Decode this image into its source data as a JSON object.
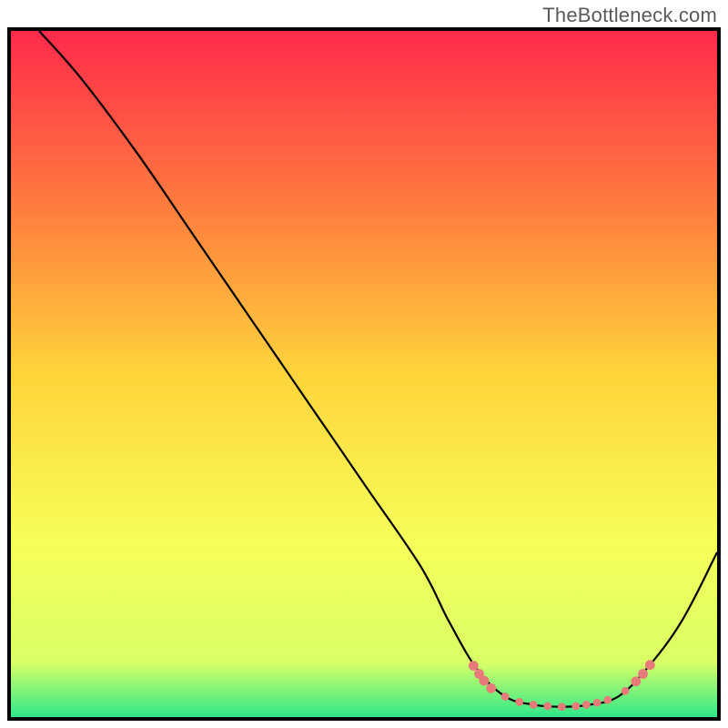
{
  "watermark": "TheBottleneck.com",
  "chart_data": {
    "type": "line",
    "title": "",
    "xlabel": "",
    "ylabel": "",
    "xlim": [
      0,
      100
    ],
    "ylim": [
      0,
      100
    ],
    "gradient_stops": [
      {
        "offset": 0,
        "color": "#ff2a4b"
      },
      {
        "offset": 25,
        "color": "#ff7a3e"
      },
      {
        "offset": 50,
        "color": "#ffd43b"
      },
      {
        "offset": 75,
        "color": "#f6ff5a"
      },
      {
        "offset": 92,
        "color": "#d9ff66"
      },
      {
        "offset": 100,
        "color": "#2ee88a"
      }
    ],
    "curve": [
      {
        "x": 4,
        "y": 100
      },
      {
        "x": 10,
        "y": 93
      },
      {
        "x": 18,
        "y": 82
      },
      {
        "x": 26,
        "y": 70
      },
      {
        "x": 34,
        "y": 58
      },
      {
        "x": 42,
        "y": 46
      },
      {
        "x": 50,
        "y": 34
      },
      {
        "x": 58,
        "y": 22
      },
      {
        "x": 62,
        "y": 14
      },
      {
        "x": 66,
        "y": 7
      },
      {
        "x": 70,
        "y": 3
      },
      {
        "x": 74,
        "y": 1.8
      },
      {
        "x": 78,
        "y": 1.5
      },
      {
        "x": 82,
        "y": 1.8
      },
      {
        "x": 86,
        "y": 3
      },
      {
        "x": 90,
        "y": 7
      },
      {
        "x": 95,
        "y": 14
      },
      {
        "x": 100,
        "y": 24
      }
    ],
    "minimum_dots": [
      {
        "x": 65.5,
        "y": 7.5
      },
      {
        "x": 66.3,
        "y": 6.3
      },
      {
        "x": 67.0,
        "y": 5.3
      },
      {
        "x": 68.0,
        "y": 4.2
      },
      {
        "x": 70.0,
        "y": 3.0
      },
      {
        "x": 72.0,
        "y": 2.2
      },
      {
        "x": 74.0,
        "y": 1.8
      },
      {
        "x": 76.0,
        "y": 1.6
      },
      {
        "x": 78.0,
        "y": 1.5
      },
      {
        "x": 80.0,
        "y": 1.6
      },
      {
        "x": 81.5,
        "y": 1.8
      },
      {
        "x": 83.0,
        "y": 2.1
      },
      {
        "x": 84.5,
        "y": 2.5
      },
      {
        "x": 87.0,
        "y": 3.8
      },
      {
        "x": 88.5,
        "y": 5.2
      },
      {
        "x": 89.5,
        "y": 6.3
      },
      {
        "x": 90.5,
        "y": 7.6
      }
    ]
  }
}
